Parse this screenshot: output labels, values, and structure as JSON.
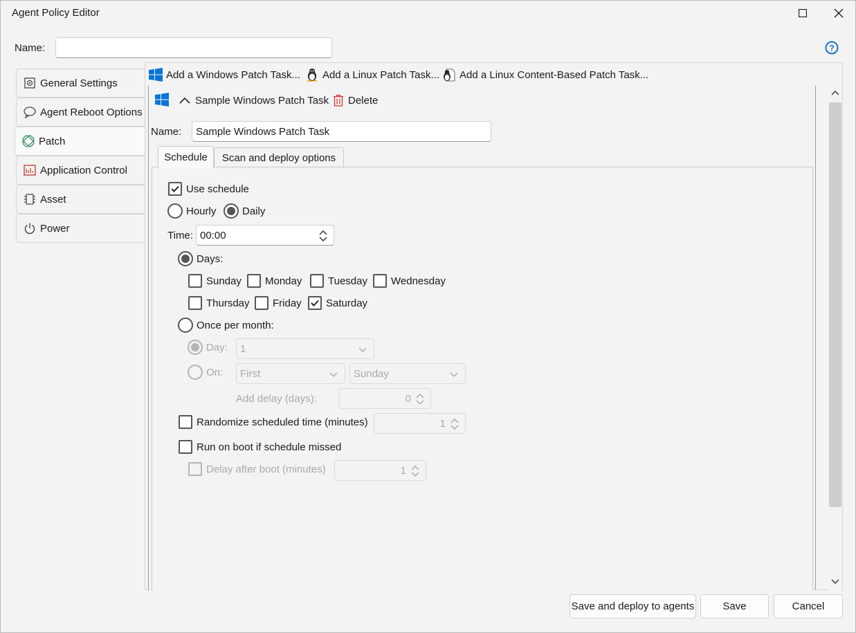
{
  "window": {
    "title": "Agent Policy Editor"
  },
  "policy": {
    "name_label": "Name:",
    "name_value": ""
  },
  "sidebar": {
    "items": [
      {
        "label": "General Settings",
        "icon": "gear-icon"
      },
      {
        "label": "Agent Reboot Options",
        "icon": "speech-bubble-icon"
      },
      {
        "label": "Patch",
        "icon": "patch-icon"
      },
      {
        "label": "Application Control",
        "icon": "application-control-icon"
      },
      {
        "label": "Asset",
        "icon": "chip-icon"
      },
      {
        "label": "Power",
        "icon": "power-icon"
      }
    ],
    "active_index": 2
  },
  "toolbar": {
    "add_windows": "Add a Windows Patch Task...",
    "add_linux": "Add a Linux Patch Task...",
    "add_linux_content": "Add a Linux Content-Based Patch Task..."
  },
  "task": {
    "header_title": "Sample Windows Patch Task",
    "delete_label": "Delete",
    "name_label": "Name:",
    "name_value": "Sample Windows Patch Task"
  },
  "tabs": [
    {
      "label": "Schedule",
      "active": true
    },
    {
      "label": "Scan and deploy options",
      "active": false
    }
  ],
  "schedule": {
    "use_schedule_label": "Use schedule",
    "use_schedule_checked": true,
    "hourly_label": "Hourly",
    "daily_label": "Daily",
    "frequency_selected": "Daily",
    "time_label": "Time:",
    "time_value": "00:00",
    "days_label": "Days:",
    "days_mode_selected": "Days",
    "days": [
      {
        "label": "Sunday",
        "checked": false
      },
      {
        "label": "Monday",
        "checked": false
      },
      {
        "label": "Tuesday",
        "checked": false
      },
      {
        "label": "Wednesday",
        "checked": false
      },
      {
        "label": "Thursday",
        "checked": false
      },
      {
        "label": "Friday",
        "checked": false
      },
      {
        "label": "Saturday",
        "checked": true
      }
    ],
    "once_per_month_label": "Once per month:",
    "day_label": "Day:",
    "day_value": "1",
    "on_label": "On:",
    "on_week_value": "First",
    "on_weekday_value": "Sunday",
    "add_delay_label": "Add delay (days):",
    "add_delay_value": "0",
    "randomize_label": "Randomize scheduled time (minutes)",
    "randomize_value": "1",
    "randomize_checked": false,
    "run_on_boot_label": "Run on boot if schedule missed",
    "run_on_boot_checked": false,
    "delay_after_boot_label": "Delay after boot (minutes)",
    "delay_after_boot_value": "1"
  },
  "buttons": {
    "save_deploy": "Save and deploy to agents",
    "save": "Save",
    "cancel": "Cancel"
  },
  "colors": {
    "accent_blue": "#0a74da",
    "delete_red": "#d9373b",
    "help_blue": "#1670c9"
  }
}
